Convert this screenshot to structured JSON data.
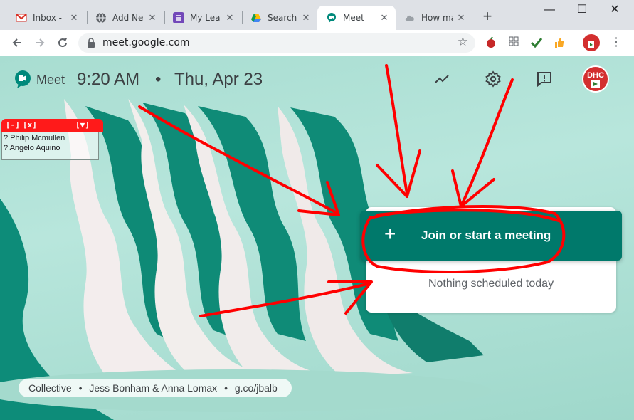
{
  "browser": {
    "tabs": [
      {
        "label": "Inbox - a",
        "icon": "gmail-icon"
      },
      {
        "label": "Add Ne",
        "icon": "globe-icon"
      },
      {
        "label": "My Lean",
        "icon": "list-icon"
      },
      {
        "label": "Search r",
        "icon": "drive-icon"
      },
      {
        "label": "Meet",
        "icon": "meet-icon",
        "active": true
      },
      {
        "label": "How ma",
        "icon": "cloud-icon"
      }
    ],
    "close_glyph": "✕",
    "new_tab_glyph": "+",
    "window_controls": {
      "minimize": "—",
      "maximize": "☐",
      "close": "✕"
    },
    "address": "meet.google.com"
  },
  "meet": {
    "brand": "Meet",
    "time": "9:20 AM",
    "separator": "•",
    "date": "Thu, Apr 23",
    "join_plus": "+",
    "join_label": "Join or start a meeting",
    "nothing_scheduled": "Nothing scheduled today",
    "avatar_text": "DHC",
    "credits": [
      "Collective",
      "•",
      "Jess Bonham & Anna Lomax",
      "•",
      "g.co/jbalb"
    ]
  },
  "participants_panel": {
    "controls": [
      "[-]",
      "[x]",
      "[▼]"
    ],
    "names": [
      "? Philip Mcmullen",
      "? Angelo Aquino"
    ]
  },
  "colors": {
    "accent_teal": "#00796b",
    "annotation_red": "#ff0000",
    "background_mint": "#b8e6dc"
  }
}
